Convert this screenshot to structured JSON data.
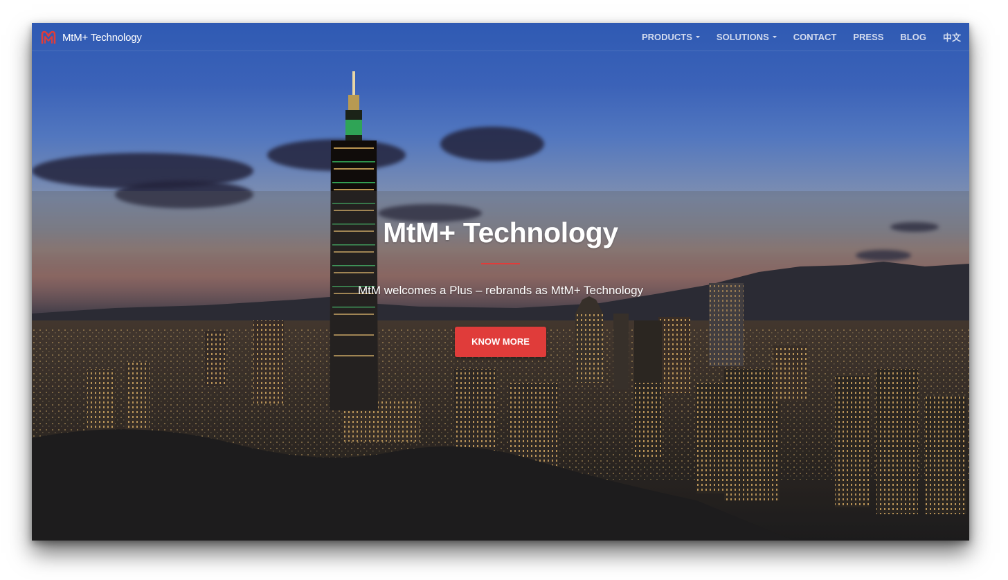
{
  "navbar": {
    "brand_name": "MtM+ Technology",
    "items": [
      {
        "label": "PRODUCTS",
        "dropdown": true
      },
      {
        "label": "SOLUTIONS",
        "dropdown": true
      },
      {
        "label": "CONTACT",
        "dropdown": false
      },
      {
        "label": "PRESS",
        "dropdown": false
      },
      {
        "label": "BLOG",
        "dropdown": false
      },
      {
        "label": "中文",
        "dropdown": false
      }
    ]
  },
  "hero": {
    "title": "MtM+ Technology",
    "subtitle": "MtM welcomes a Plus – rebrands as MtM+ Technology",
    "button_label": "KNOW MORE"
  },
  "colors": {
    "accent": "#e03c3a",
    "nav_text": "#d4dcef",
    "text": "#ffffff"
  },
  "icons": {
    "brand_logo": "mtm-logo-icon",
    "dropdown": "caret-down-icon"
  }
}
